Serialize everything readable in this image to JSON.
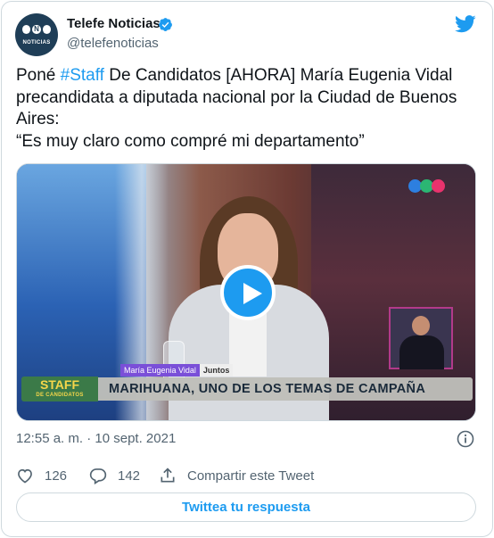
{
  "author": {
    "name": "Telefe Noticias",
    "handle": "@telefenoticias",
    "avatar_logo_text": "NOTICIAS",
    "verified": true
  },
  "tweet": {
    "text_before": "Poné ",
    "hashtag": "#Staff",
    "text_after": " De Candidatos [AHORA] María Eugenia Vidal precandidata a diputada nacional por la Ciudad de Buenos Aires:",
    "quote": "“Es muy claro como compré mi departamento”"
  },
  "media": {
    "name_tag_name": "María Eugenia Vidal",
    "name_tag_party": "Juntos",
    "staff_badge_title": "STAFF",
    "staff_badge_subtitle": "DE CANDIDATOS",
    "headline": "MARIHUANA, UNO DE LOS TEMAS DE CAMPAÑA"
  },
  "meta": {
    "timestamp": "12:55 a. m. · 10 sept. 2021"
  },
  "actions": {
    "likes": "126",
    "replies": "142",
    "share_label": "Compartir este Tweet"
  },
  "reply_button": {
    "label": "Twittea tu respuesta"
  },
  "colors": {
    "accent": "#1d9bf0",
    "text": "#0f1419",
    "muted": "#536471",
    "border": "#cfd9de"
  },
  "icons": [
    "verified-badge-icon",
    "twitter-bird-icon",
    "play-icon",
    "info-icon",
    "heart-icon",
    "reply-bubble-icon",
    "share-icon"
  ]
}
